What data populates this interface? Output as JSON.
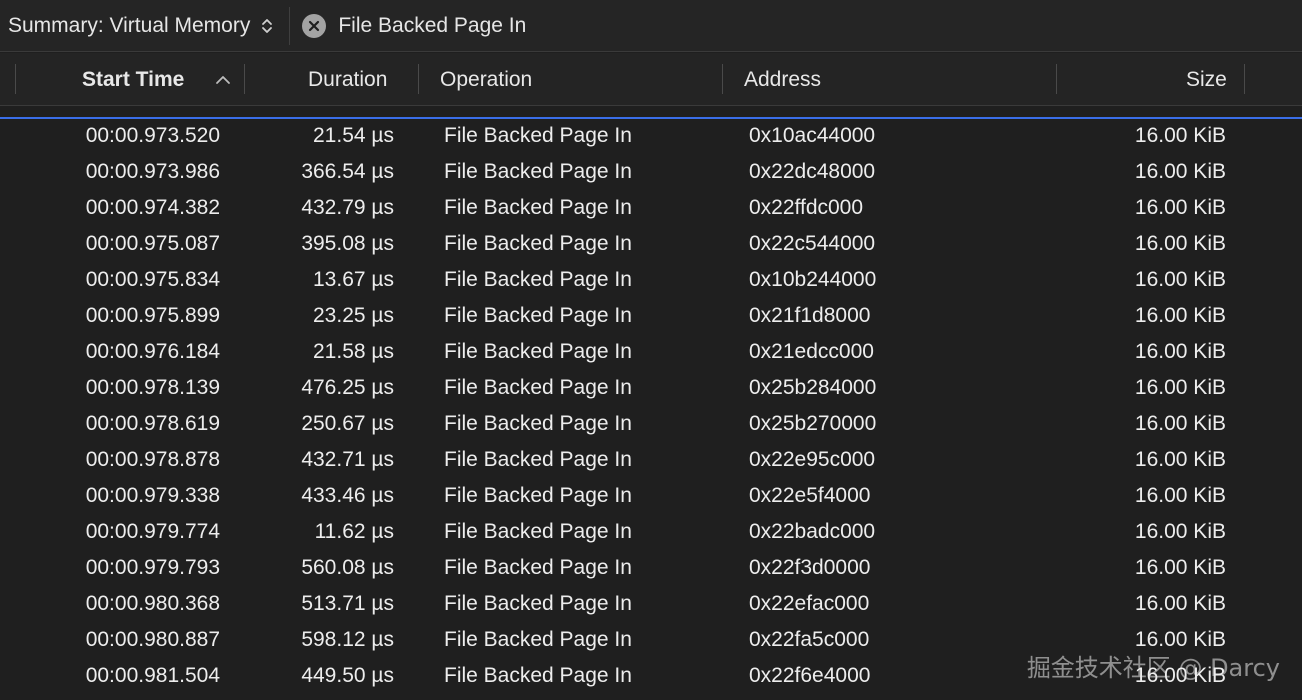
{
  "toolbar": {
    "summary_label": "Summary: Virtual Memory",
    "filter_label": "File Backed Page In",
    "icons": {
      "summary_selector": "updown-chevron-icon",
      "filter_clear": "clear-x-icon"
    }
  },
  "table": {
    "columns": {
      "start_time": "Start Time",
      "duration": "Duration",
      "operation": "Operation",
      "address": "Address",
      "size": "Size"
    },
    "sort": {
      "column": "start_time",
      "direction": "ascending"
    },
    "rows": [
      {
        "start": "00:00.973.520",
        "duration": "21.54 µs",
        "operation": "File Backed Page In",
        "address": "0x10ac44000",
        "size": "16.00 KiB"
      },
      {
        "start": "00:00.973.986",
        "duration": "366.54 µs",
        "operation": "File Backed Page In",
        "address": "0x22dc48000",
        "size": "16.00 KiB"
      },
      {
        "start": "00:00.974.382",
        "duration": "432.79 µs",
        "operation": "File Backed Page In",
        "address": "0x22ffdc000",
        "size": "16.00 KiB"
      },
      {
        "start": "00:00.975.087",
        "duration": "395.08 µs",
        "operation": "File Backed Page In",
        "address": "0x22c544000",
        "size": "16.00 KiB"
      },
      {
        "start": "00:00.975.834",
        "duration": "13.67 µs",
        "operation": "File Backed Page In",
        "address": "0x10b244000",
        "size": "16.00 KiB"
      },
      {
        "start": "00:00.975.899",
        "duration": "23.25 µs",
        "operation": "File Backed Page In",
        "address": "0x21f1d8000",
        "size": "16.00 KiB"
      },
      {
        "start": "00:00.976.184",
        "duration": "21.58 µs",
        "operation": "File Backed Page In",
        "address": "0x21edcc000",
        "size": "16.00 KiB"
      },
      {
        "start": "00:00.978.139",
        "duration": "476.25 µs",
        "operation": "File Backed Page In",
        "address": "0x25b284000",
        "size": "16.00 KiB"
      },
      {
        "start": "00:00.978.619",
        "duration": "250.67 µs",
        "operation": "File Backed Page In",
        "address": "0x25b270000",
        "size": "16.00 KiB"
      },
      {
        "start": "00:00.978.878",
        "duration": "432.71 µs",
        "operation": "File Backed Page In",
        "address": "0x22e95c000",
        "size": "16.00 KiB"
      },
      {
        "start": "00:00.979.338",
        "duration": "433.46 µs",
        "operation": "File Backed Page In",
        "address": "0x22e5f4000",
        "size": "16.00 KiB"
      },
      {
        "start": "00:00.979.774",
        "duration": "11.62 µs",
        "operation": "File Backed Page In",
        "address": "0x22badc000",
        "size": "16.00 KiB"
      },
      {
        "start": "00:00.979.793",
        "duration": "560.08 µs",
        "operation": "File Backed Page In",
        "address": "0x22f3d0000",
        "size": "16.00 KiB"
      },
      {
        "start": "00:00.980.368",
        "duration": "513.71 µs",
        "operation": "File Backed Page In",
        "address": "0x22efac000",
        "size": "16.00 KiB"
      },
      {
        "start": "00:00.980.887",
        "duration": "598.12 µs",
        "operation": "File Backed Page In",
        "address": "0x22fa5c000",
        "size": "16.00 KiB"
      },
      {
        "start": "00:00.981.504",
        "duration": "449.50 µs",
        "operation": "File Backed Page In",
        "address": "0x22f6e4000",
        "size": "16.00 KiB"
      }
    ]
  },
  "watermark": "掘金技术社区 @ Darcy",
  "colors": {
    "background": "#1f1f1f",
    "text": "#ececec",
    "selection_line": "#3a6ee8"
  }
}
